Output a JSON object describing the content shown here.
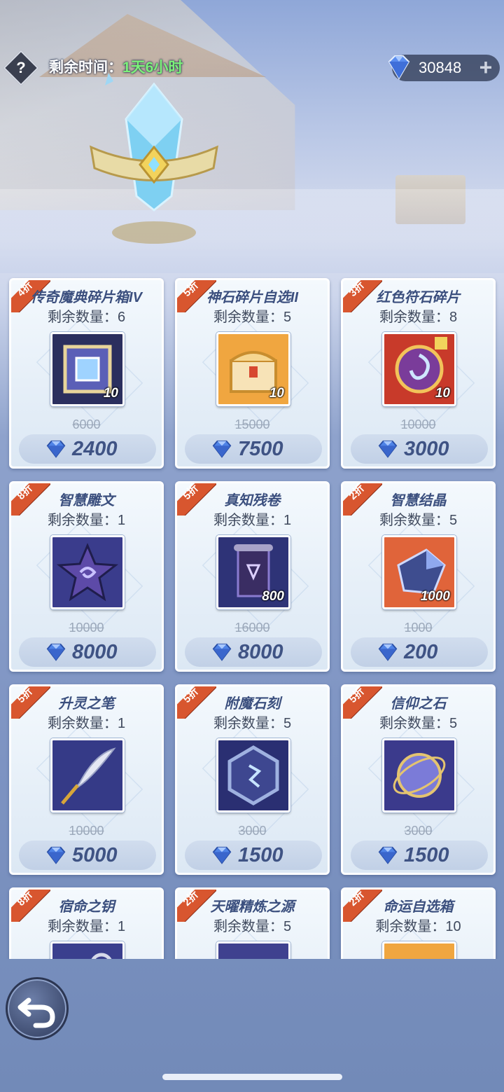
{
  "header": {
    "help_icon": "question-mark",
    "timer_label": "剩余时间：",
    "timer_value": "1天6小时",
    "currency_icon": "diamond-gem",
    "currency_amount": "30848",
    "add_currency_icon": "plus"
  },
  "colors": {
    "badge": "#d8562f",
    "title": "#3b4f7e",
    "timer_value": "#7df07a",
    "price": "#3f5384"
  },
  "items": [
    {
      "discount": "4折",
      "name": "传奇魔典碎片箱IV",
      "stock_label": "剩余数量：",
      "stock": "6",
      "count": "10",
      "old_price": "6000",
      "price": "2400",
      "icon": "ornate-cube"
    },
    {
      "discount": "5折",
      "name": "神石碎片自选II",
      "stock_label": "剩余数量：",
      "stock": "5",
      "count": "10",
      "old_price": "15000",
      "price": "7500",
      "icon": "golden-chest"
    },
    {
      "discount": "3折",
      "name": "红色符石碎片",
      "stock_label": "剩余数量：",
      "stock": "8",
      "count": "10",
      "old_price": "10000",
      "price": "3000",
      "icon": "red-rune-fragment"
    },
    {
      "discount": "8折",
      "name": "智慧雕文",
      "stock_label": "剩余数量：",
      "stock": "1",
      "count": "",
      "old_price": "10000",
      "price": "8000",
      "icon": "star-glyph"
    },
    {
      "discount": "5折",
      "name": "真知残卷",
      "stock_label": "剩余数量：",
      "stock": "1",
      "count": "800",
      "old_price": "16000",
      "price": "8000",
      "icon": "scroll"
    },
    {
      "discount": "2折",
      "name": "智慧结晶",
      "stock_label": "剩余数量：",
      "stock": "5",
      "count": "1000",
      "old_price": "1000",
      "price": "200",
      "icon": "crystal"
    },
    {
      "discount": "5折",
      "name": "升灵之笔",
      "stock_label": "剩余数量：",
      "stock": "1",
      "count": "",
      "old_price": "10000",
      "price": "5000",
      "icon": "feather-quill"
    },
    {
      "discount": "5折",
      "name": "附魔石刻",
      "stock_label": "剩余数量：",
      "stock": "5",
      "count": "",
      "old_price": "3000",
      "price": "1500",
      "icon": "hexagon-stone"
    },
    {
      "discount": "5折",
      "name": "信仰之石",
      "stock_label": "剩余数量：",
      "stock": "5",
      "count": "",
      "old_price": "3000",
      "price": "1500",
      "icon": "orb-stone"
    },
    {
      "discount": "8折",
      "name": "宿命之钥",
      "stock_label": "剩余数量：",
      "stock": "1",
      "count": "",
      "old_price": "",
      "price": "",
      "icon": "key"
    },
    {
      "discount": "2折",
      "name": "天曜精炼之源",
      "stock_label": "剩余数量：",
      "stock": "5",
      "count": "",
      "old_price": "",
      "price": "",
      "icon": "refine-source"
    },
    {
      "discount": "2折",
      "name": "命运自选箱",
      "stock_label": "剩余数量：",
      "stock": "10",
      "count": "",
      "old_price": "",
      "price": "",
      "icon": "fate-box"
    }
  ],
  "footer": {
    "back_icon": "back-arrow"
  }
}
